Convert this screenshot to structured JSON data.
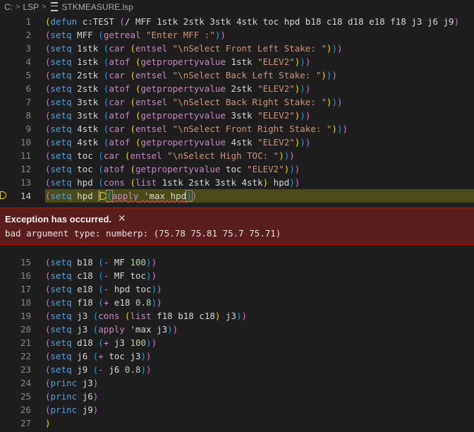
{
  "breadcrumb": {
    "drive": "C:",
    "folder": "LSP",
    "file": "STKMEASURE.lsp"
  },
  "editor": {
    "current_line": 14,
    "lines": [
      {
        "num": "1",
        "tokens": [
          [
            "p1",
            "("
          ],
          [
            "fn",
            "defun"
          ],
          [
            "var",
            " c:TEST "
          ],
          [
            "p2",
            "("
          ],
          [
            "var",
            "/ MFF 1stk 2stk 3stk 4stk toc hpd b18 c18 d18 e18 f18 j3 j6 j9"
          ],
          [
            "p2",
            ")"
          ]
        ]
      },
      {
        "num": "2",
        "tokens": [
          [
            "p2",
            "("
          ],
          [
            "fn",
            "setq"
          ],
          [
            "var",
            " MFF "
          ],
          [
            "p3",
            "("
          ],
          [
            "bi",
            "getreal"
          ],
          [
            "str",
            " \"Enter MFF :\""
          ],
          [
            "p3",
            ")"
          ],
          [
            "p2",
            ")"
          ]
        ]
      },
      {
        "num": "3",
        "tokens": [
          [
            "p2",
            "("
          ],
          [
            "fn",
            "setq"
          ],
          [
            "var",
            " 1stk "
          ],
          [
            "p3",
            "("
          ],
          [
            "bi",
            "car"
          ],
          [
            "var",
            " "
          ],
          [
            "p1",
            "("
          ],
          [
            "bi",
            "entsel"
          ],
          [
            "str",
            " \"\\nSelect Front Left Stake: \""
          ],
          [
            "p1",
            ")"
          ],
          [
            "p3",
            ")"
          ],
          [
            "p2",
            ")"
          ]
        ]
      },
      {
        "num": "4",
        "tokens": [
          [
            "p2",
            "("
          ],
          [
            "fn",
            "setq"
          ],
          [
            "var",
            " 1stk "
          ],
          [
            "p3",
            "("
          ],
          [
            "bi",
            "atof"
          ],
          [
            "var",
            " "
          ],
          [
            "p1",
            "("
          ],
          [
            "bi",
            "getpropertyvalue"
          ],
          [
            "var",
            " 1stk "
          ],
          [
            "str",
            "\"ELEV2\""
          ],
          [
            "p1",
            ")"
          ],
          [
            "p3",
            ")"
          ],
          [
            "p2",
            ")"
          ]
        ]
      },
      {
        "num": "5",
        "tokens": [
          [
            "p2",
            "("
          ],
          [
            "fn",
            "setq"
          ],
          [
            "var",
            " 2stk "
          ],
          [
            "p3",
            "("
          ],
          [
            "bi",
            "car"
          ],
          [
            "var",
            " "
          ],
          [
            "p1",
            "("
          ],
          [
            "bi",
            "entsel"
          ],
          [
            "str",
            " \"\\nSelect Back Left Stake: \""
          ],
          [
            "p1",
            ")"
          ],
          [
            "p3",
            ")"
          ],
          [
            "p2",
            ")"
          ]
        ]
      },
      {
        "num": "6",
        "tokens": [
          [
            "p2",
            "("
          ],
          [
            "fn",
            "setq"
          ],
          [
            "var",
            " 2stk "
          ],
          [
            "p3",
            "("
          ],
          [
            "bi",
            "atof"
          ],
          [
            "var",
            " "
          ],
          [
            "p1",
            "("
          ],
          [
            "bi",
            "getpropertyvalue"
          ],
          [
            "var",
            " 2stk "
          ],
          [
            "str",
            "\"ELEV2\""
          ],
          [
            "p1",
            ")"
          ],
          [
            "p3",
            ")"
          ],
          [
            "p2",
            ")"
          ]
        ]
      },
      {
        "num": "7",
        "tokens": [
          [
            "p2",
            "("
          ],
          [
            "fn",
            "setq"
          ],
          [
            "var",
            " 3stk "
          ],
          [
            "p3",
            "("
          ],
          [
            "bi",
            "car"
          ],
          [
            "var",
            " "
          ],
          [
            "p1",
            "("
          ],
          [
            "bi",
            "entsel"
          ],
          [
            "str",
            " \"\\nSelect Back Right Stake: \""
          ],
          [
            "p1",
            ")"
          ],
          [
            "p3",
            ")"
          ],
          [
            "p2",
            ")"
          ]
        ]
      },
      {
        "num": "8",
        "tokens": [
          [
            "p2",
            "("
          ],
          [
            "fn",
            "setq"
          ],
          [
            "var",
            " 3stk "
          ],
          [
            "p3",
            "("
          ],
          [
            "bi",
            "atof"
          ],
          [
            "var",
            " "
          ],
          [
            "p1",
            "("
          ],
          [
            "bi",
            "getpropertyvalue"
          ],
          [
            "var",
            " 3stk "
          ],
          [
            "str",
            "\"ELEV2\""
          ],
          [
            "p1",
            ")"
          ],
          [
            "p3",
            ")"
          ],
          [
            "p2",
            ")"
          ]
        ]
      },
      {
        "num": "9",
        "tokens": [
          [
            "p2",
            "("
          ],
          [
            "fn",
            "setq"
          ],
          [
            "var",
            " 4stk "
          ],
          [
            "p3",
            "("
          ],
          [
            "bi",
            "car"
          ],
          [
            "var",
            " "
          ],
          [
            "p1",
            "("
          ],
          [
            "bi",
            "entsel"
          ],
          [
            "str",
            " \"\\nSelect Front Right Stake: \""
          ],
          [
            "p1",
            ")"
          ],
          [
            "p3",
            ")"
          ],
          [
            "p2",
            ")"
          ]
        ]
      },
      {
        "num": "10",
        "tokens": [
          [
            "p2",
            "("
          ],
          [
            "fn",
            "setq"
          ],
          [
            "var",
            " 4stk "
          ],
          [
            "p3",
            "("
          ],
          [
            "bi",
            "atof"
          ],
          [
            "var",
            " "
          ],
          [
            "p1",
            "("
          ],
          [
            "bi",
            "getpropertyvalue"
          ],
          [
            "var",
            " 4stk "
          ],
          [
            "str",
            "\"ELEV2\""
          ],
          [
            "p1",
            ")"
          ],
          [
            "p3",
            ")"
          ],
          [
            "p2",
            ")"
          ]
        ]
      },
      {
        "num": "11",
        "tokens": [
          [
            "p2",
            "("
          ],
          [
            "fn",
            "setq"
          ],
          [
            "var",
            " toc "
          ],
          [
            "p3",
            "("
          ],
          [
            "bi",
            "car"
          ],
          [
            "var",
            " "
          ],
          [
            "p1",
            "("
          ],
          [
            "bi",
            "entsel"
          ],
          [
            "str",
            " \"\\nSelect High TOC: \""
          ],
          [
            "p1",
            ")"
          ],
          [
            "p3",
            ")"
          ],
          [
            "p2",
            ")"
          ]
        ]
      },
      {
        "num": "12",
        "tokens": [
          [
            "p2",
            "("
          ],
          [
            "fn",
            "setq"
          ],
          [
            "var",
            " toc "
          ],
          [
            "p3",
            "("
          ],
          [
            "bi",
            "atof"
          ],
          [
            "var",
            " "
          ],
          [
            "p1",
            "("
          ],
          [
            "bi",
            "getpropertyvalue"
          ],
          [
            "var",
            " toc "
          ],
          [
            "str",
            "\"ELEV2\""
          ],
          [
            "p1",
            ")"
          ],
          [
            "p3",
            ")"
          ],
          [
            "p2",
            ")"
          ]
        ]
      },
      {
        "num": "13",
        "tokens": [
          [
            "p2",
            "("
          ],
          [
            "fn",
            "setq"
          ],
          [
            "var",
            " hpd "
          ],
          [
            "p3",
            "("
          ],
          [
            "bi",
            "cons"
          ],
          [
            "var",
            " "
          ],
          [
            "p1",
            "("
          ],
          [
            "bi",
            "list"
          ],
          [
            "var",
            " 1stk 2stk 3stk 4stk"
          ],
          [
            "p1",
            ")"
          ],
          [
            "var",
            " hpd"
          ],
          [
            "p3",
            ")"
          ],
          [
            "p2",
            ")"
          ]
        ]
      }
    ],
    "line14": {
      "num": "14",
      "setq": "setq",
      "var": " hpd ",
      "apply": "apply",
      "rest": " 'max hpd"
    },
    "lines_after": [
      {
        "num": "15",
        "tokens": [
          [
            "p2",
            "("
          ],
          [
            "fn",
            "setq"
          ],
          [
            "var",
            " b18 "
          ],
          [
            "p3",
            "("
          ],
          [
            "bi",
            "-"
          ],
          [
            "var",
            " MF "
          ],
          [
            "num",
            "100"
          ],
          [
            "p3",
            ")"
          ],
          [
            "p2",
            ")"
          ]
        ]
      },
      {
        "num": "16",
        "tokens": [
          [
            "p2",
            "("
          ],
          [
            "fn",
            "setq"
          ],
          [
            "var",
            " c18 "
          ],
          [
            "p3",
            "("
          ],
          [
            "bi",
            "-"
          ],
          [
            "var",
            " MF toc"
          ],
          [
            "p3",
            ")"
          ],
          [
            "p2",
            ")"
          ]
        ]
      },
      {
        "num": "17",
        "tokens": [
          [
            "p2",
            "("
          ],
          [
            "fn",
            "setq"
          ],
          [
            "var",
            " e18 "
          ],
          [
            "p3",
            "("
          ],
          [
            "bi",
            "-"
          ],
          [
            "var",
            " hpd toc"
          ],
          [
            "p3",
            ")"
          ],
          [
            "p2",
            ")"
          ]
        ]
      },
      {
        "num": "18",
        "tokens": [
          [
            "p2",
            "("
          ],
          [
            "fn",
            "setq"
          ],
          [
            "var",
            " f18 "
          ],
          [
            "p3",
            "("
          ],
          [
            "bi",
            "+"
          ],
          [
            "var",
            " e18 "
          ],
          [
            "num",
            "0.8"
          ],
          [
            "p3",
            ")"
          ],
          [
            "p2",
            ")"
          ]
        ]
      },
      {
        "num": "19",
        "tokens": [
          [
            "p2",
            "("
          ],
          [
            "fn",
            "setq"
          ],
          [
            "var",
            " j3 "
          ],
          [
            "p3",
            "("
          ],
          [
            "bi",
            "cons"
          ],
          [
            "var",
            " "
          ],
          [
            "p1",
            "("
          ],
          [
            "bi",
            "list"
          ],
          [
            "var",
            " f18 b18 c18"
          ],
          [
            "p1",
            ")"
          ],
          [
            "var",
            " j3"
          ],
          [
            "p3",
            ")"
          ],
          [
            "p2",
            ")"
          ]
        ]
      },
      {
        "num": "20",
        "tokens": [
          [
            "p2",
            "("
          ],
          [
            "fn",
            "setq"
          ],
          [
            "var",
            " j3 "
          ],
          [
            "p3",
            "("
          ],
          [
            "bi",
            "apply"
          ],
          [
            "var",
            " 'max j3"
          ],
          [
            "p3",
            ")"
          ],
          [
            "p2",
            ")"
          ]
        ]
      },
      {
        "num": "21",
        "tokens": [
          [
            "p2",
            "("
          ],
          [
            "fn",
            "setq"
          ],
          [
            "var",
            " d18 "
          ],
          [
            "p3",
            "("
          ],
          [
            "bi",
            "+"
          ],
          [
            "var",
            " j3 "
          ],
          [
            "num",
            "100"
          ],
          [
            "p3",
            ")"
          ],
          [
            "p2",
            ")"
          ]
        ]
      },
      {
        "num": "22",
        "tokens": [
          [
            "p2",
            "("
          ],
          [
            "fn",
            "setq"
          ],
          [
            "var",
            " j6 "
          ],
          [
            "p3",
            "("
          ],
          [
            "bi",
            "+"
          ],
          [
            "var",
            " toc j3"
          ],
          [
            "p3",
            ")"
          ],
          [
            "p2",
            ")"
          ]
        ]
      },
      {
        "num": "23",
        "tokens": [
          [
            "p2",
            "("
          ],
          [
            "fn",
            "setq"
          ],
          [
            "var",
            " j9 "
          ],
          [
            "p3",
            "("
          ],
          [
            "bi",
            "-"
          ],
          [
            "var",
            " j6 "
          ],
          [
            "num",
            "0.8"
          ],
          [
            "p3",
            ")"
          ],
          [
            "p2",
            ")"
          ]
        ]
      },
      {
        "num": "24",
        "tokens": [
          [
            "p2",
            "("
          ],
          [
            "fn",
            "princ"
          ],
          [
            "var",
            " j3"
          ],
          [
            "p2",
            ")"
          ]
        ]
      },
      {
        "num": "25",
        "tokens": [
          [
            "p2",
            "("
          ],
          [
            "fn",
            "princ"
          ],
          [
            "var",
            " j6"
          ],
          [
            "p2",
            ")"
          ]
        ]
      },
      {
        "num": "26",
        "tokens": [
          [
            "p2",
            "("
          ],
          [
            "fn",
            "princ"
          ],
          [
            "var",
            " j9"
          ],
          [
            "p2",
            ")"
          ]
        ]
      },
      {
        "num": "27",
        "tokens": [
          [
            "p1",
            ")"
          ]
        ]
      }
    ]
  },
  "exception": {
    "title": "Exception has occurred.",
    "close_glyph": "✕",
    "message": "bad argument type: numberp: (75.78 75.81 75.7 75.71)"
  }
}
